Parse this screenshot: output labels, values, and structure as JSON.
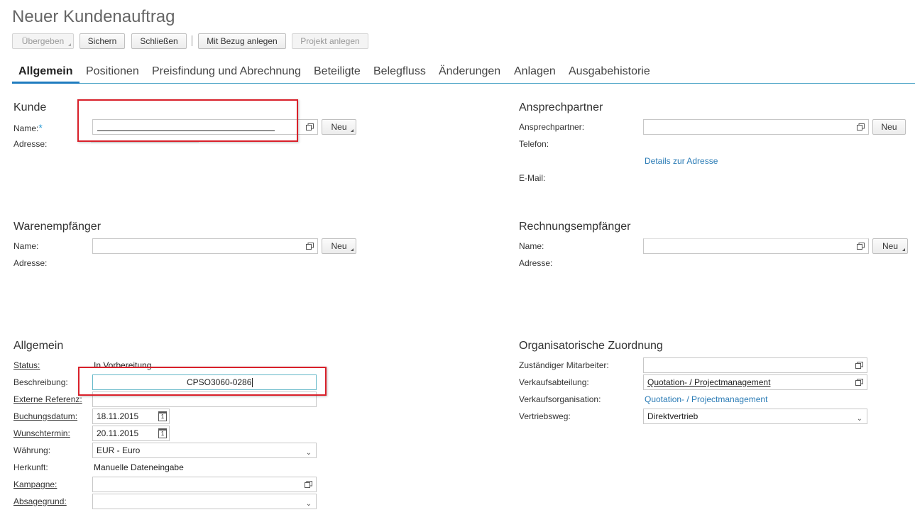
{
  "page": {
    "title": "Neuer Kundenauftrag"
  },
  "toolbar": {
    "submit": "Übergeben",
    "save": "Sichern",
    "close": "Schließen",
    "create_ref": "Mit Bezug anlegen",
    "create_project": "Projekt anlegen"
  },
  "tabs": [
    "Allgemein",
    "Positionen",
    "Preisfindung und Abrechnung",
    "Beteiligte",
    "Belegfluss",
    "Änderungen",
    "Anlagen",
    "Ausgabehistorie"
  ],
  "kunde": {
    "title": "Kunde",
    "name_label": "Name:",
    "required_marker": "*",
    "address_label": "Adresse:",
    "new_button": "Neu"
  },
  "ansprechpartner": {
    "title": "Ansprechpartner",
    "contact_label": "Ansprechpartner:",
    "phone_label": "Telefon:",
    "details_link": "Details zur Adresse",
    "email_label": "E-Mail:",
    "new_button": "Neu"
  },
  "warenempfaenger": {
    "title": "Warenempfänger",
    "name_label": "Name:",
    "address_label": "Adresse:",
    "new_button": "Neu"
  },
  "rechnungsempfaenger": {
    "title": "Rechnungsempfänger",
    "name_label": "Name:",
    "address_label": "Adresse:",
    "new_button": "Neu"
  },
  "allgemein": {
    "title": "Allgemein",
    "status_label": "Status:",
    "status_value": "In Vorbereitung",
    "description_label": "Beschreibung:",
    "description_value": "CPSO3060-0286",
    "ext_ref_label": "Externe Referenz:",
    "booking_date_label": "Buchungsdatum:",
    "booking_date_value": "18.11.2015",
    "wish_date_label": "Wunschtermin:",
    "wish_date_value": "20.11.2015",
    "currency_label": "Währung:",
    "currency_value": "EUR - Euro",
    "origin_label": "Herkunft:",
    "origin_value": "Manuelle Dateneingabe",
    "campaign_label": "Kampagne:",
    "cancel_reason_label": "Absagegrund:",
    "calendar_day": "1"
  },
  "org": {
    "title": "Organisatorische Zuordnung",
    "employee_label": "Zuständiger Mitarbeiter:",
    "sales_unit_label": "Verkaufsabteilung:",
    "sales_unit_value": "Quotation- / Projectmanagement",
    "sales_org_label": "Verkaufsorganisation:",
    "sales_org_value": "Quotation- / Projectmanagement",
    "channel_label": "Vertriebsweg:",
    "channel_value": "Direktvertrieb"
  },
  "colors": {
    "accent": "#1f7cbf",
    "highlight": "#d9202a",
    "link": "#2a7bb5"
  },
  "icons": {
    "value_help": "value-help-icon",
    "dropdown": "chevron-down-icon",
    "calendar": "calendar-icon"
  }
}
